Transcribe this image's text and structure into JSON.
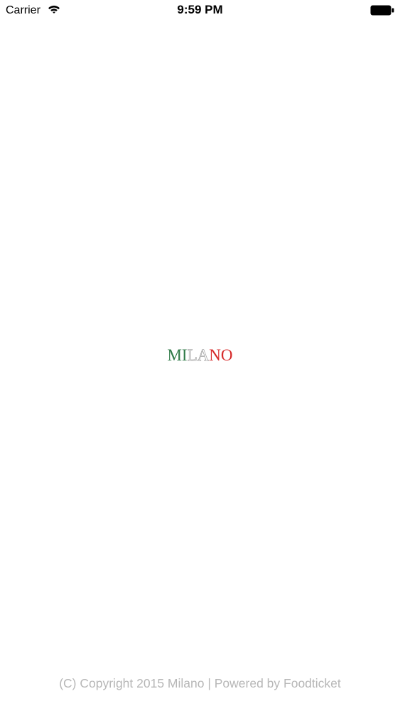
{
  "status_bar": {
    "carrier": "Carrier",
    "time": "9:59 PM",
    "icons": {
      "wifi": "wifi-icon",
      "battery": "battery-icon"
    }
  },
  "logo": {
    "parts": [
      "MI",
      "LA",
      "NO"
    ],
    "colors": {
      "green": "#2f7a47",
      "white": "#ffffff",
      "red": "#d62a2a"
    }
  },
  "footer": {
    "text": "(C) Copyright 2015 Milano | Powered by Foodticket"
  }
}
